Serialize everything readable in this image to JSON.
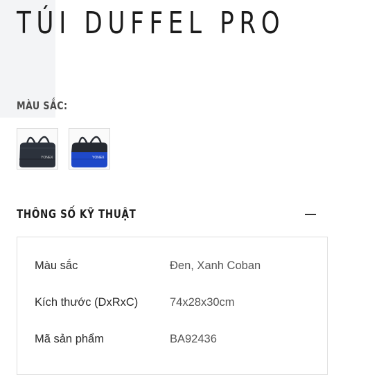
{
  "product": {
    "title": "TÚI DUFFEL PRO"
  },
  "color_section": {
    "label": "MÀU SẮC:",
    "swatches": [
      {
        "name": "Đen",
        "color": "#2a2f38"
      },
      {
        "name": "Xanh Coban",
        "color": "#1f49c9"
      }
    ]
  },
  "specs": {
    "title": "THÔNG SỐ KỸ THUẬT",
    "collapse_icon": "minus-icon",
    "rows": [
      {
        "label": "Màu sắc",
        "value": "Đen, Xanh Coban"
      },
      {
        "label": "Kích thước (DxRxC)",
        "value": "74x28x30cm"
      },
      {
        "label": "Mã sản phẩm",
        "value": "BA92436"
      }
    ]
  }
}
